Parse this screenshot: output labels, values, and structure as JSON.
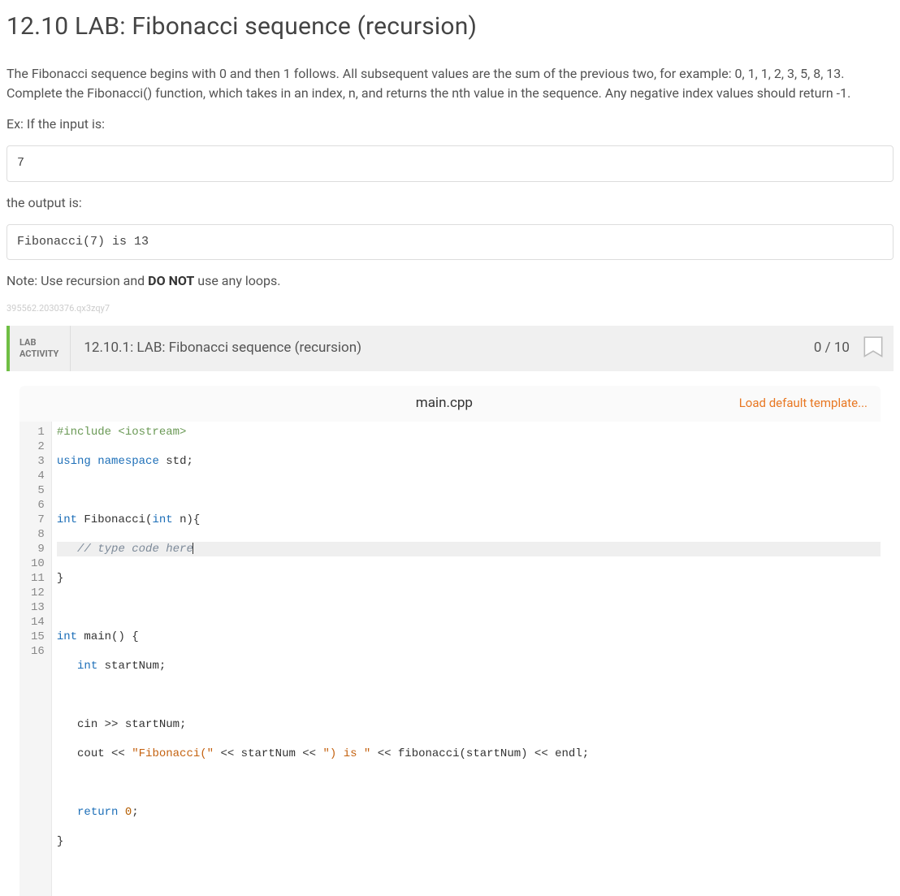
{
  "page": {
    "title": "12.10 LAB: Fibonacci sequence (recursion)",
    "description": "The Fibonacci sequence begins with 0 and then 1 follows. All subsequent values are the sum of the previous two, for example: 0, 1, 1, 2, 3, 5, 8, 13. Complete the Fibonacci() function, which takes in an index, n, and returns the nth value in the sequence. Any negative index values should return -1.",
    "ex_intro": "Ex: If the input is:",
    "ex_input": "7",
    "ex_output_intro": "the output is:",
    "ex_output": "Fibonacci(7) is 13",
    "note_prefix": "Note: Use recursion and ",
    "note_strong": "DO NOT",
    "note_suffix": " use any loops.",
    "faint_id": "395562.2030376.qx3zqy7"
  },
  "lab": {
    "badge_line1": "LAB",
    "badge_line2": "ACTIVITY",
    "title": "12.10.1: LAB: Fibonacci sequence (recursion)",
    "score": "0 / 10"
  },
  "editor": {
    "filename": "main.cpp",
    "load_template": "Load default template...",
    "highlight_line": 5,
    "code_lines": [
      [
        {
          "t": "pre",
          "v": "#include <iostream>"
        }
      ],
      [
        {
          "t": "kw",
          "v": "using"
        },
        {
          "t": "",
          "v": " "
        },
        {
          "t": "kw",
          "v": "namespace"
        },
        {
          "t": "",
          "v": " std;"
        }
      ],
      [],
      [
        {
          "t": "type",
          "v": "int"
        },
        {
          "t": "",
          "v": " Fibonacci("
        },
        {
          "t": "type",
          "v": "int"
        },
        {
          "t": "",
          "v": " n){"
        }
      ],
      [
        {
          "t": "",
          "v": "   "
        },
        {
          "t": "cmt",
          "v": "// type code here"
        },
        {
          "t": "cursor",
          "v": ""
        }
      ],
      [
        {
          "t": "",
          "v": "}"
        }
      ],
      [],
      [
        {
          "t": "type",
          "v": "int"
        },
        {
          "t": "",
          "v": " main() {"
        }
      ],
      [
        {
          "t": "",
          "v": "   "
        },
        {
          "t": "type",
          "v": "int"
        },
        {
          "t": "",
          "v": " startNum;"
        }
      ],
      [],
      [
        {
          "t": "",
          "v": "   cin >> startNum;"
        }
      ],
      [
        {
          "t": "",
          "v": "   cout << "
        },
        {
          "t": "str",
          "v": "\"Fibonacci(\""
        },
        {
          "t": "",
          "v": " << startNum << "
        },
        {
          "t": "str",
          "v": "\") is \""
        },
        {
          "t": "",
          "v": " << fibonacci(startNum) << endl;"
        }
      ],
      [],
      [
        {
          "t": "",
          "v": "   "
        },
        {
          "t": "kw",
          "v": "return"
        },
        {
          "t": "",
          "v": " "
        },
        {
          "t": "num",
          "v": "0"
        },
        {
          "t": "",
          "v": ";"
        }
      ],
      [
        {
          "t": "",
          "v": "}"
        }
      ],
      []
    ]
  }
}
